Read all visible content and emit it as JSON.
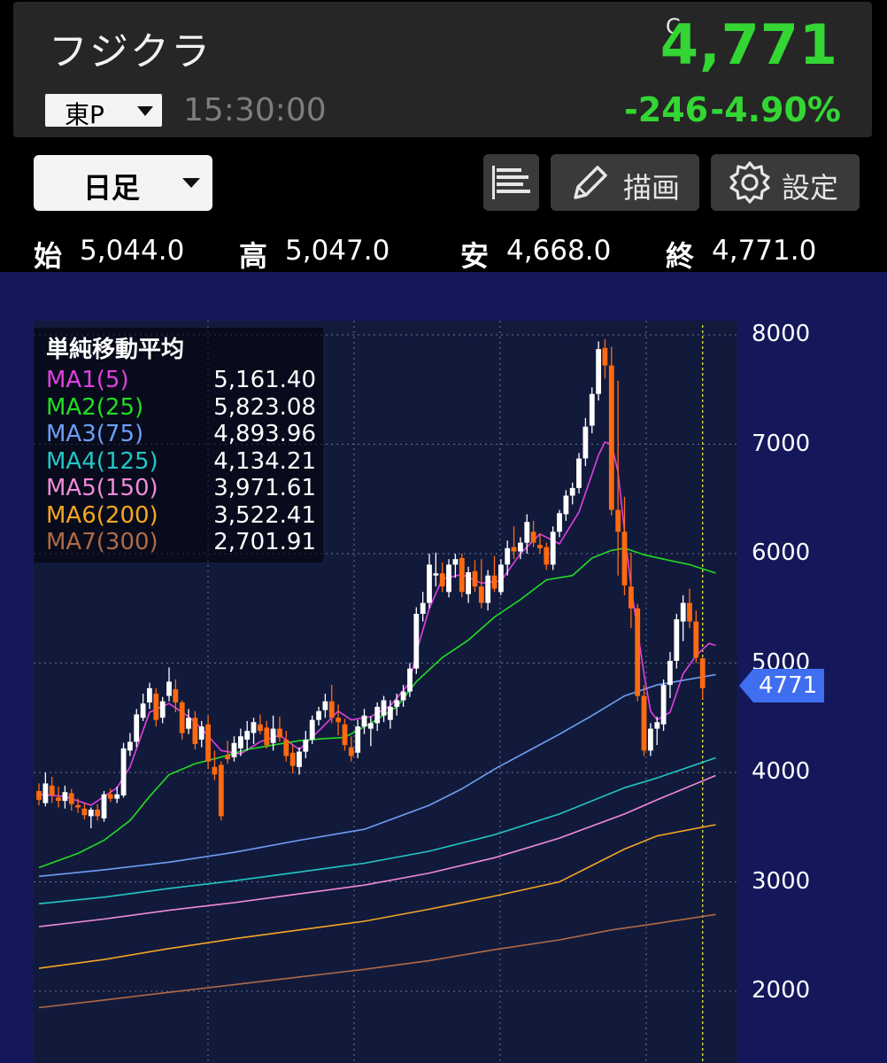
{
  "header": {
    "stock_name": "フジクラ",
    "market": "東P",
    "time": "15:30:00",
    "price_flag": "C",
    "price": "4,771",
    "change": "-246",
    "change_pct": "-4.90%",
    "up_color": "#33d633"
  },
  "toolbar": {
    "period": "日足",
    "list_icon": "list-icon",
    "draw_label": "描画",
    "draw_icon": "pencil-icon",
    "settings_label": "設定",
    "settings_icon": "gear-icon"
  },
  "ohlc": {
    "open_label": "始",
    "open": "5,044.0",
    "high_label": "高",
    "high": "5,047.0",
    "low_label": "安",
    "low": "4,668.0",
    "close_label": "終",
    "close": "4,771.0"
  },
  "legend": {
    "title": "単純移動平均",
    "items": [
      {
        "name": "MA1(5)",
        "value": "5,161.40",
        "color": "#e040e0"
      },
      {
        "name": "MA2(25)",
        "value": "5,823.08",
        "color": "#22dd22"
      },
      {
        "name": "MA3(75)",
        "value": "4,893.96",
        "color": "#6f9ef5"
      },
      {
        "name": "MA4(125)",
        "value": "4,134.21",
        "color": "#22c7c7"
      },
      {
        "name": "MA5(150)",
        "value": "3,971.61",
        "color": "#f08ad8"
      },
      {
        "name": "MA6(200)",
        "value": "3,522.41",
        "color": "#f5a623"
      },
      {
        "name": "MA7(300)",
        "value": "2,701.91",
        "color": "#b06a45"
      }
    ]
  },
  "chart_data": {
    "type": "candlestick",
    "y_ticks": [
      "8000",
      "7000",
      "6000",
      "5000",
      "4000",
      "3000",
      "2000"
    ],
    "ylim": [
      1500,
      8100
    ],
    "last_price_label": "4771",
    "up_color": "#ffffff",
    "down_color": "#ff6a10",
    "background": "#14185a",
    "candles": [
      [
        3830,
        3900,
        3700,
        3750
      ],
      [
        3720,
        4000,
        3690,
        3900
      ],
      [
        3880,
        3960,
        3720,
        3790
      ],
      [
        3770,
        3870,
        3680,
        3740
      ],
      [
        3740,
        3880,
        3670,
        3820
      ],
      [
        3810,
        3850,
        3650,
        3710
      ],
      [
        3700,
        3760,
        3630,
        3680
      ],
      [
        3670,
        3720,
        3570,
        3610
      ],
      [
        3600,
        3680,
        3490,
        3660
      ],
      [
        3660,
        3710,
        3560,
        3600
      ],
      [
        3580,
        3830,
        3550,
        3800
      ],
      [
        3800,
        3850,
        3730,
        3760
      ],
      [
        3760,
        3870,
        3720,
        3800
      ],
      [
        3790,
        4270,
        3770,
        4220
      ],
      [
        4200,
        4360,
        4150,
        4280
      ],
      [
        4280,
        4580,
        4230,
        4530
      ],
      [
        4500,
        4720,
        4470,
        4630
      ],
      [
        4640,
        4820,
        4580,
        4770
      ],
      [
        4720,
        4770,
        4420,
        4480
      ],
      [
        4500,
        4690,
        4450,
        4650
      ],
      [
        4700,
        4960,
        4650,
        4830
      ],
      [
        4760,
        4850,
        4550,
        4640
      ],
      [
        4640,
        4660,
        4300,
        4360
      ],
      [
        4400,
        4580,
        4350,
        4500
      ],
      [
        4500,
        4560,
        4210,
        4260
      ],
      [
        4300,
        4470,
        4230,
        4420
      ],
      [
        4440,
        4520,
        4030,
        4100
      ],
      [
        4050,
        4200,
        3930,
        3980
      ],
      [
        4070,
        4100,
        3560,
        3600
      ],
      [
        4160,
        4290,
        4080,
        4120
      ],
      [
        4140,
        4330,
        4100,
        4270
      ],
      [
        4220,
        4400,
        4150,
        4330
      ],
      [
        4300,
        4470,
        4200,
        4380
      ],
      [
        4360,
        4500,
        4260,
        4460
      ],
      [
        4440,
        4530,
        4350,
        4380
      ],
      [
        4410,
        4470,
        4220,
        4250
      ],
      [
        4270,
        4520,
        4200,
        4400
      ],
      [
        4400,
        4510,
        4280,
        4320
      ],
      [
        4300,
        4380,
        4100,
        4150
      ],
      [
        4180,
        4250,
        3990,
        4060
      ],
      [
        4050,
        4230,
        3980,
        4190
      ],
      [
        4190,
        4380,
        4130,
        4300
      ],
      [
        4300,
        4520,
        4260,
        4480
      ],
      [
        4480,
        4600,
        4430,
        4560
      ],
      [
        4570,
        4720,
        4500,
        4650
      ],
      [
        4650,
        4800,
        4450,
        4500
      ],
      [
        4500,
        4620,
        4340,
        4460
      ],
      [
        4440,
        4490,
        4200,
        4250
      ],
      [
        4230,
        4330,
        4100,
        4150
      ],
      [
        4180,
        4480,
        4130,
        4420
      ],
      [
        4420,
        4580,
        4350,
        4520
      ],
      [
        4400,
        4510,
        4240,
        4450
      ],
      [
        4450,
        4640,
        4380,
        4600
      ],
      [
        4520,
        4700,
        4460,
        4660
      ],
      [
        4480,
        4660,
        4400,
        4600
      ],
      [
        4600,
        4720,
        4520,
        4660
      ],
      [
        4660,
        4800,
        4600,
        4740
      ],
      [
        4740,
        5000,
        4690,
        4950
      ],
      [
        4950,
        5510,
        4900,
        5450
      ],
      [
        5450,
        5650,
        5380,
        5550
      ],
      [
        5550,
        6000,
        5500,
        5900
      ],
      [
        5800,
        6010,
        5700,
        5820
      ],
      [
        5820,
        5920,
        5650,
        5700
      ],
      [
        5650,
        5950,
        5600,
        5900
      ],
      [
        5900,
        6000,
        5780,
        5950
      ],
      [
        5960,
        6000,
        5600,
        5650
      ],
      [
        5630,
        5880,
        5550,
        5830
      ],
      [
        5840,
        5940,
        5650,
        5700
      ],
      [
        5700,
        5950,
        5500,
        5550
      ],
      [
        5550,
        5850,
        5480,
        5800
      ],
      [
        5800,
        5980,
        5650,
        5680
      ],
      [
        5650,
        5950,
        5620,
        5900
      ],
      [
        5900,
        6120,
        5800,
        6050
      ],
      [
        6060,
        6250,
        5950,
        6020
      ],
      [
        6020,
        6150,
        5950,
        6100
      ],
      [
        6100,
        6360,
        6000,
        6290
      ],
      [
        6200,
        6300,
        6060,
        6100
      ],
      [
        6080,
        6180,
        6000,
        6050
      ],
      [
        6060,
        6100,
        5850,
        5900
      ],
      [
        5900,
        6250,
        5850,
        6200
      ],
      [
        6200,
        6400,
        6150,
        6370
      ],
      [
        6360,
        6580,
        6300,
        6530
      ],
      [
        6530,
        6650,
        6450,
        6600
      ],
      [
        6600,
        6920,
        6550,
        6870
      ],
      [
        6870,
        7240,
        6800,
        7160
      ],
      [
        7170,
        7520,
        7100,
        7460
      ],
      [
        7460,
        7940,
        7400,
        7870
      ],
      [
        7880,
        7960,
        7600,
        7720
      ],
      [
        7720,
        7890,
        6350,
        6400
      ],
      [
        6400,
        7580,
        5800,
        6200
      ],
      [
        6200,
        6520,
        5620,
        5710
      ],
      [
        5700,
        6010,
        5320,
        5500
      ],
      [
        5500,
        5540,
        4650,
        4700
      ],
      [
        4700,
        4800,
        4150,
        4200
      ],
      [
        4200,
        4450,
        4150,
        4400
      ],
      [
        4400,
        4510,
        4250,
        4460
      ],
      [
        4440,
        4850,
        4380,
        4800
      ],
      [
        4800,
        5100,
        4680,
        5020
      ],
      [
        5020,
        5450,
        4950,
        5400
      ],
      [
        5380,
        5620,
        5200,
        5550
      ],
      [
        5550,
        5680,
        5320,
        5380
      ],
      [
        5380,
        5480,
        5000,
        5050
      ],
      [
        5044,
        5047,
        4668,
        4771
      ]
    ],
    "moving_averages": [
      {
        "name": "MA1(5)",
        "color": "#e040e0",
        "points": [
          [
            0,
            3800
          ],
          [
            4,
            3780
          ],
          [
            8,
            3700
          ],
          [
            12,
            3860
          ],
          [
            14,
            4050
          ],
          [
            17,
            4550
          ],
          [
            20,
            4630
          ],
          [
            23,
            4510
          ],
          [
            25,
            4400
          ],
          [
            28,
            4200
          ],
          [
            31,
            4170
          ],
          [
            34,
            4280
          ],
          [
            37,
            4340
          ],
          [
            40,
            4210
          ],
          [
            43,
            4380
          ],
          [
            46,
            4560
          ],
          [
            48,
            4480
          ],
          [
            51,
            4510
          ],
          [
            54,
            4610
          ],
          [
            57,
            4820
          ],
          [
            58,
            5100
          ],
          [
            60,
            5500
          ],
          [
            62,
            5770
          ],
          [
            65,
            5810
          ],
          [
            68,
            5730
          ],
          [
            71,
            5750
          ],
          [
            74,
            6000
          ],
          [
            77,
            6180
          ],
          [
            80,
            6090
          ],
          [
            83,
            6380
          ],
          [
            86,
            6900
          ],
          [
            87,
            7020
          ],
          [
            88,
            7000
          ],
          [
            89,
            6750
          ],
          [
            90,
            6200
          ],
          [
            91,
            5700
          ],
          [
            92,
            5300
          ],
          [
            93,
            4900
          ],
          [
            94,
            4560
          ],
          [
            95,
            4480
          ],
          [
            97,
            4550
          ],
          [
            99,
            4900
          ],
          [
            101,
            5070
          ],
          [
            103,
            5180
          ],
          [
            104,
            5161
          ]
        ]
      },
      {
        "name": "MA2(25)",
        "color": "#22dd22",
        "points": [
          [
            0,
            3130
          ],
          [
            6,
            3260
          ],
          [
            10,
            3380
          ],
          [
            14,
            3560
          ],
          [
            17,
            3780
          ],
          [
            20,
            3980
          ],
          [
            24,
            4080
          ],
          [
            28,
            4140
          ],
          [
            32,
            4210
          ],
          [
            36,
            4250
          ],
          [
            40,
            4290
          ],
          [
            44,
            4310
          ],
          [
            47,
            4320
          ],
          [
            51,
            4450
          ],
          [
            55,
            4600
          ],
          [
            58,
            4830
          ],
          [
            62,
            5050
          ],
          [
            66,
            5210
          ],
          [
            70,
            5420
          ],
          [
            74,
            5580
          ],
          [
            78,
            5760
          ],
          [
            82,
            5800
          ],
          [
            85,
            5960
          ],
          [
            88,
            6030
          ],
          [
            90,
            6050
          ],
          [
            93,
            5990
          ],
          [
            96,
            5950
          ],
          [
            100,
            5900
          ],
          [
            104,
            5823
          ]
        ]
      },
      {
        "name": "MA3(75)",
        "color": "#6f9ef5",
        "points": [
          [
            0,
            3050
          ],
          [
            10,
            3110
          ],
          [
            20,
            3180
          ],
          [
            30,
            3270
          ],
          [
            40,
            3380
          ],
          [
            50,
            3480
          ],
          [
            55,
            3590
          ],
          [
            60,
            3700
          ],
          [
            65,
            3850
          ],
          [
            70,
            4030
          ],
          [
            75,
            4190
          ],
          [
            80,
            4350
          ],
          [
            85,
            4520
          ],
          [
            90,
            4700
          ],
          [
            95,
            4800
          ],
          [
            104,
            4894
          ]
        ]
      },
      {
        "name": "MA4(125)",
        "color": "#22c7c7",
        "points": [
          [
            0,
            2800
          ],
          [
            10,
            2860
          ],
          [
            20,
            2940
          ],
          [
            30,
            3010
          ],
          [
            40,
            3090
          ],
          [
            50,
            3170
          ],
          [
            60,
            3280
          ],
          [
            70,
            3430
          ],
          [
            80,
            3620
          ],
          [
            90,
            3860
          ],
          [
            95,
            3950
          ],
          [
            104,
            4134
          ]
        ]
      },
      {
        "name": "MA5(150)",
        "color": "#f08ad8",
        "points": [
          [
            0,
            2590
          ],
          [
            10,
            2660
          ],
          [
            20,
            2740
          ],
          [
            30,
            2810
          ],
          [
            40,
            2890
          ],
          [
            50,
            2970
          ],
          [
            60,
            3080
          ],
          [
            70,
            3220
          ],
          [
            80,
            3400
          ],
          [
            90,
            3620
          ],
          [
            95,
            3750
          ],
          [
            104,
            3972
          ]
        ]
      },
      {
        "name": "MA6(200)",
        "color": "#f5a623",
        "points": [
          [
            0,
            2210
          ],
          [
            10,
            2290
          ],
          [
            20,
            2390
          ],
          [
            30,
            2480
          ],
          [
            40,
            2560
          ],
          [
            50,
            2640
          ],
          [
            60,
            2750
          ],
          [
            70,
            2870
          ],
          [
            80,
            3000
          ],
          [
            85,
            3150
          ],
          [
            90,
            3300
          ],
          [
            95,
            3420
          ],
          [
            104,
            3522
          ]
        ]
      },
      {
        "name": "MA7(300)",
        "color": "#b06a45",
        "points": [
          [
            0,
            1850
          ],
          [
            10,
            1920
          ],
          [
            20,
            1990
          ],
          [
            30,
            2060
          ],
          [
            40,
            2130
          ],
          [
            50,
            2200
          ],
          [
            60,
            2280
          ],
          [
            70,
            2380
          ],
          [
            80,
            2470
          ],
          [
            88,
            2560
          ],
          [
            95,
            2620
          ],
          [
            104,
            2702
          ]
        ]
      }
    ]
  }
}
